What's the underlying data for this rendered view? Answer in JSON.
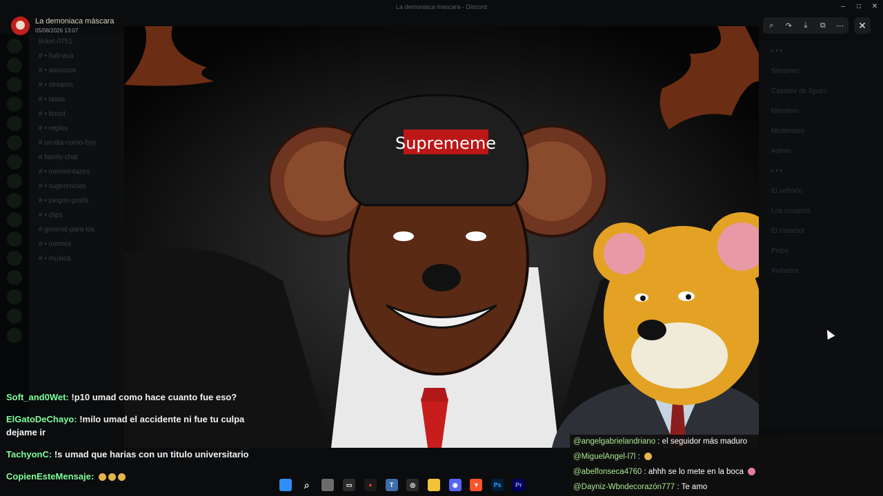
{
  "window": {
    "title": "La demoniaca mascara - Discord"
  },
  "viewer": {
    "author": "La demoniaca máscara",
    "timestamp": "05/08/2026 13:07",
    "tools": [
      {
        "icon": "zoom-icon",
        "glyph": "⌕"
      },
      {
        "icon": "forward-icon",
        "glyph": "↷"
      },
      {
        "icon": "download-icon",
        "glyph": "⤓"
      },
      {
        "icon": "open-external-icon",
        "glyph": "⧉"
      },
      {
        "icon": "more-icon",
        "glyph": "⋯"
      }
    ],
    "close_glyph": "✕"
  },
  "artwork": {
    "cap_text": "Suprememe"
  },
  "background_app": {
    "channels": [
      "ticket-0751",
      "# • hub-aca",
      "# • anuncios",
      "# • streams",
      "# • tasas",
      "# • boost",
      "# • reglas",
      "# un-dia-como-hoy",
      "# family-chat",
      "# • memeintazes",
      "# • sugerencias",
      "# • juegos-gratis",
      "# • clips",
      "# general-para-los",
      "# • memes",
      "# • musica"
    ],
    "members": [
      "• • •",
      "Streamer",
      "Cazador de ligues",
      "Miembro",
      "Moderador",
      "Admin",
      "• • •",
      "El señorío",
      "Los usuarios",
      "El redactor",
      "Pelos",
      "Invitados"
    ]
  },
  "stream_chat": [
    {
      "user": "Soft_and0Wet:",
      "message": " !p10 umad como hace cuanto fue eso?"
    },
    {
      "user": "ElGatoDeChayo:",
      "message": " !milo umad el accidente ni fue tu culpa dejame ir"
    },
    {
      "user": "TachyonC:",
      "message": " !s umad que harias con un titulo universitario"
    },
    {
      "user": "CopienEsteMensaje:",
      "message": ""
    }
  ],
  "youtube_chat": [
    {
      "user": "@angelgabrielandriano",
      "message": " : el seguidor más maduro"
    },
    {
      "user": "@MiguelAngel-l7l",
      "message": " : "
    },
    {
      "user": "@abelfonseca4760",
      "message": " : ahhh se lo mete en la boca "
    },
    {
      "user": "@Dayniz-Wbndecorazón777",
      "message": " : Te amo"
    }
  ],
  "taskbar": [
    {
      "icon": "windows-start-icon",
      "color": "#2f8df5",
      "glyph": ""
    },
    {
      "icon": "search-icon",
      "color": "transparent",
      "glyph": "⌕"
    },
    {
      "icon": "obs-icon",
      "color": "#6b6b6b",
      "glyph": ""
    },
    {
      "icon": "terminal-icon",
      "color": "#2b2b2b",
      "glyph": "▭"
    },
    {
      "icon": "record-icon",
      "color": "#1b1b1b",
      "glyph": "●"
    },
    {
      "icon": "text-app-icon",
      "color": "#3e6da8",
      "glyph": "T"
    },
    {
      "icon": "obs-studio-icon",
      "color": "#2a2a2a",
      "glyph": "◎"
    },
    {
      "icon": "file-explorer-icon",
      "color": "#f3c13a",
      "glyph": ""
    },
    {
      "icon": "discord-icon",
      "color": "#5865f2",
      "glyph": "◉"
    },
    {
      "icon": "brave-icon",
      "color": "#fb542b",
      "glyph": "▼"
    },
    {
      "icon": "photoshop-icon",
      "color": "#001e36",
      "glyph": "Ps"
    },
    {
      "icon": "premiere-icon",
      "color": "#00005b",
      "glyph": "Pr"
    }
  ]
}
